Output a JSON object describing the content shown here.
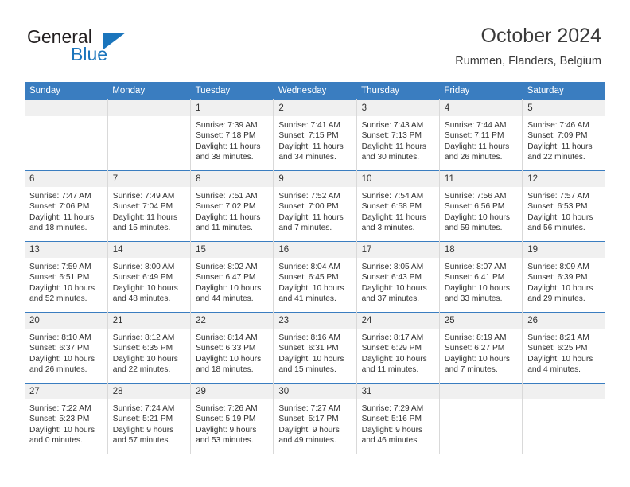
{
  "brand": {
    "name_top": "General",
    "name_bottom": "Blue",
    "color_top": "#231f20",
    "color_bottom": "#1b75bc"
  },
  "header": {
    "title": "October 2024",
    "subtitle": "Rummen, Flanders, Belgium"
  },
  "theme": {
    "header_blue": "#3a7dc0",
    "daynum_bg": "#f0f0f0",
    "cell_border": "#d9d9d9",
    "text": "#333333"
  },
  "weekday_headers": [
    "Sunday",
    "Monday",
    "Tuesday",
    "Wednesday",
    "Thursday",
    "Friday",
    "Saturday"
  ],
  "weeks": [
    [
      {
        "day": "",
        "sunrise": "",
        "sunset": "",
        "daylight_line1": "",
        "daylight_line2": "",
        "empty": true
      },
      {
        "day": "",
        "sunrise": "",
        "sunset": "",
        "daylight_line1": "",
        "daylight_line2": "",
        "empty": true
      },
      {
        "day": "1",
        "sunrise": "Sunrise: 7:39 AM",
        "sunset": "Sunset: 7:18 PM",
        "daylight_line1": "Daylight: 11 hours",
        "daylight_line2": "and 38 minutes."
      },
      {
        "day": "2",
        "sunrise": "Sunrise: 7:41 AM",
        "sunset": "Sunset: 7:15 PM",
        "daylight_line1": "Daylight: 11 hours",
        "daylight_line2": "and 34 minutes."
      },
      {
        "day": "3",
        "sunrise": "Sunrise: 7:43 AM",
        "sunset": "Sunset: 7:13 PM",
        "daylight_line1": "Daylight: 11 hours",
        "daylight_line2": "and 30 minutes."
      },
      {
        "day": "4",
        "sunrise": "Sunrise: 7:44 AM",
        "sunset": "Sunset: 7:11 PM",
        "daylight_line1": "Daylight: 11 hours",
        "daylight_line2": "and 26 minutes."
      },
      {
        "day": "5",
        "sunrise": "Sunrise: 7:46 AM",
        "sunset": "Sunset: 7:09 PM",
        "daylight_line1": "Daylight: 11 hours",
        "daylight_line2": "and 22 minutes."
      }
    ],
    [
      {
        "day": "6",
        "sunrise": "Sunrise: 7:47 AM",
        "sunset": "Sunset: 7:06 PM",
        "daylight_line1": "Daylight: 11 hours",
        "daylight_line2": "and 18 minutes."
      },
      {
        "day": "7",
        "sunrise": "Sunrise: 7:49 AM",
        "sunset": "Sunset: 7:04 PM",
        "daylight_line1": "Daylight: 11 hours",
        "daylight_line2": "and 15 minutes."
      },
      {
        "day": "8",
        "sunrise": "Sunrise: 7:51 AM",
        "sunset": "Sunset: 7:02 PM",
        "daylight_line1": "Daylight: 11 hours",
        "daylight_line2": "and 11 minutes."
      },
      {
        "day": "9",
        "sunrise": "Sunrise: 7:52 AM",
        "sunset": "Sunset: 7:00 PM",
        "daylight_line1": "Daylight: 11 hours",
        "daylight_line2": "and 7 minutes."
      },
      {
        "day": "10",
        "sunrise": "Sunrise: 7:54 AM",
        "sunset": "Sunset: 6:58 PM",
        "daylight_line1": "Daylight: 11 hours",
        "daylight_line2": "and 3 minutes."
      },
      {
        "day": "11",
        "sunrise": "Sunrise: 7:56 AM",
        "sunset": "Sunset: 6:56 PM",
        "daylight_line1": "Daylight: 10 hours",
        "daylight_line2": "and 59 minutes."
      },
      {
        "day": "12",
        "sunrise": "Sunrise: 7:57 AM",
        "sunset": "Sunset: 6:53 PM",
        "daylight_line1": "Daylight: 10 hours",
        "daylight_line2": "and 56 minutes."
      }
    ],
    [
      {
        "day": "13",
        "sunrise": "Sunrise: 7:59 AM",
        "sunset": "Sunset: 6:51 PM",
        "daylight_line1": "Daylight: 10 hours",
        "daylight_line2": "and 52 minutes."
      },
      {
        "day": "14",
        "sunrise": "Sunrise: 8:00 AM",
        "sunset": "Sunset: 6:49 PM",
        "daylight_line1": "Daylight: 10 hours",
        "daylight_line2": "and 48 minutes."
      },
      {
        "day": "15",
        "sunrise": "Sunrise: 8:02 AM",
        "sunset": "Sunset: 6:47 PM",
        "daylight_line1": "Daylight: 10 hours",
        "daylight_line2": "and 44 minutes."
      },
      {
        "day": "16",
        "sunrise": "Sunrise: 8:04 AM",
        "sunset": "Sunset: 6:45 PM",
        "daylight_line1": "Daylight: 10 hours",
        "daylight_line2": "and 41 minutes."
      },
      {
        "day": "17",
        "sunrise": "Sunrise: 8:05 AM",
        "sunset": "Sunset: 6:43 PM",
        "daylight_line1": "Daylight: 10 hours",
        "daylight_line2": "and 37 minutes."
      },
      {
        "day": "18",
        "sunrise": "Sunrise: 8:07 AM",
        "sunset": "Sunset: 6:41 PM",
        "daylight_line1": "Daylight: 10 hours",
        "daylight_line2": "and 33 minutes."
      },
      {
        "day": "19",
        "sunrise": "Sunrise: 8:09 AM",
        "sunset": "Sunset: 6:39 PM",
        "daylight_line1": "Daylight: 10 hours",
        "daylight_line2": "and 29 minutes."
      }
    ],
    [
      {
        "day": "20",
        "sunrise": "Sunrise: 8:10 AM",
        "sunset": "Sunset: 6:37 PM",
        "daylight_line1": "Daylight: 10 hours",
        "daylight_line2": "and 26 minutes."
      },
      {
        "day": "21",
        "sunrise": "Sunrise: 8:12 AM",
        "sunset": "Sunset: 6:35 PM",
        "daylight_line1": "Daylight: 10 hours",
        "daylight_line2": "and 22 minutes."
      },
      {
        "day": "22",
        "sunrise": "Sunrise: 8:14 AM",
        "sunset": "Sunset: 6:33 PM",
        "daylight_line1": "Daylight: 10 hours",
        "daylight_line2": "and 18 minutes."
      },
      {
        "day": "23",
        "sunrise": "Sunrise: 8:16 AM",
        "sunset": "Sunset: 6:31 PM",
        "daylight_line1": "Daylight: 10 hours",
        "daylight_line2": "and 15 minutes."
      },
      {
        "day": "24",
        "sunrise": "Sunrise: 8:17 AM",
        "sunset": "Sunset: 6:29 PM",
        "daylight_line1": "Daylight: 10 hours",
        "daylight_line2": "and 11 minutes."
      },
      {
        "day": "25",
        "sunrise": "Sunrise: 8:19 AM",
        "sunset": "Sunset: 6:27 PM",
        "daylight_line1": "Daylight: 10 hours",
        "daylight_line2": "and 7 minutes."
      },
      {
        "day": "26",
        "sunrise": "Sunrise: 8:21 AM",
        "sunset": "Sunset: 6:25 PM",
        "daylight_line1": "Daylight: 10 hours",
        "daylight_line2": "and 4 minutes."
      }
    ],
    [
      {
        "day": "27",
        "sunrise": "Sunrise: 7:22 AM",
        "sunset": "Sunset: 5:23 PM",
        "daylight_line1": "Daylight: 10 hours",
        "daylight_line2": "and 0 minutes."
      },
      {
        "day": "28",
        "sunrise": "Sunrise: 7:24 AM",
        "sunset": "Sunset: 5:21 PM",
        "daylight_line1": "Daylight: 9 hours",
        "daylight_line2": "and 57 minutes."
      },
      {
        "day": "29",
        "sunrise": "Sunrise: 7:26 AM",
        "sunset": "Sunset: 5:19 PM",
        "daylight_line1": "Daylight: 9 hours",
        "daylight_line2": "and 53 minutes."
      },
      {
        "day": "30",
        "sunrise": "Sunrise: 7:27 AM",
        "sunset": "Sunset: 5:17 PM",
        "daylight_line1": "Daylight: 9 hours",
        "daylight_line2": "and 49 minutes."
      },
      {
        "day": "31",
        "sunrise": "Sunrise: 7:29 AM",
        "sunset": "Sunset: 5:16 PM",
        "daylight_line1": "Daylight: 9 hours",
        "daylight_line2": "and 46 minutes."
      },
      {
        "day": "",
        "sunrise": "",
        "sunset": "",
        "daylight_line1": "",
        "daylight_line2": "",
        "empty": true
      },
      {
        "day": "",
        "sunrise": "",
        "sunset": "",
        "daylight_line1": "",
        "daylight_line2": "",
        "empty": true
      }
    ]
  ]
}
